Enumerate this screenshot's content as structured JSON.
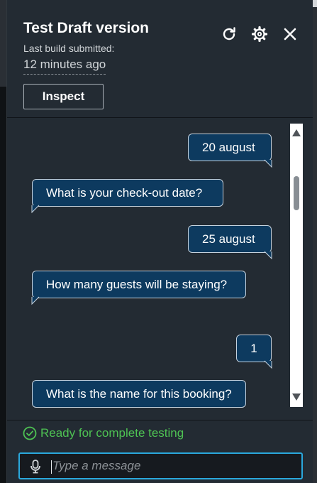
{
  "header": {
    "title": "Test Draft version",
    "subtitle": "Last build submitted:",
    "time": "12 minutes ago",
    "inspect_label": "Inspect",
    "icons": [
      "refresh-icon",
      "settings-gear-icon",
      "close-icon"
    ]
  },
  "messages": [
    {
      "role": "user",
      "text": "20 august"
    },
    {
      "role": "bot",
      "text": "What is your check-out date?"
    },
    {
      "role": "user",
      "text": "25 august"
    },
    {
      "role": "bot",
      "text": "How many guests will be staying?"
    },
    {
      "role": "user",
      "text": "1"
    },
    {
      "role": "bot",
      "text": "What is the name for this booking?"
    }
  ],
  "status": {
    "text": "Ready for complete testing",
    "icon": "check-circle-icon",
    "color": "#4ec253"
  },
  "input": {
    "placeholder": "Type a message",
    "value": "",
    "icon": "microphone-icon"
  },
  "colors": {
    "panel": "#232b33",
    "bubble": "#0d3a5f",
    "accent": "#2aa8dc"
  }
}
